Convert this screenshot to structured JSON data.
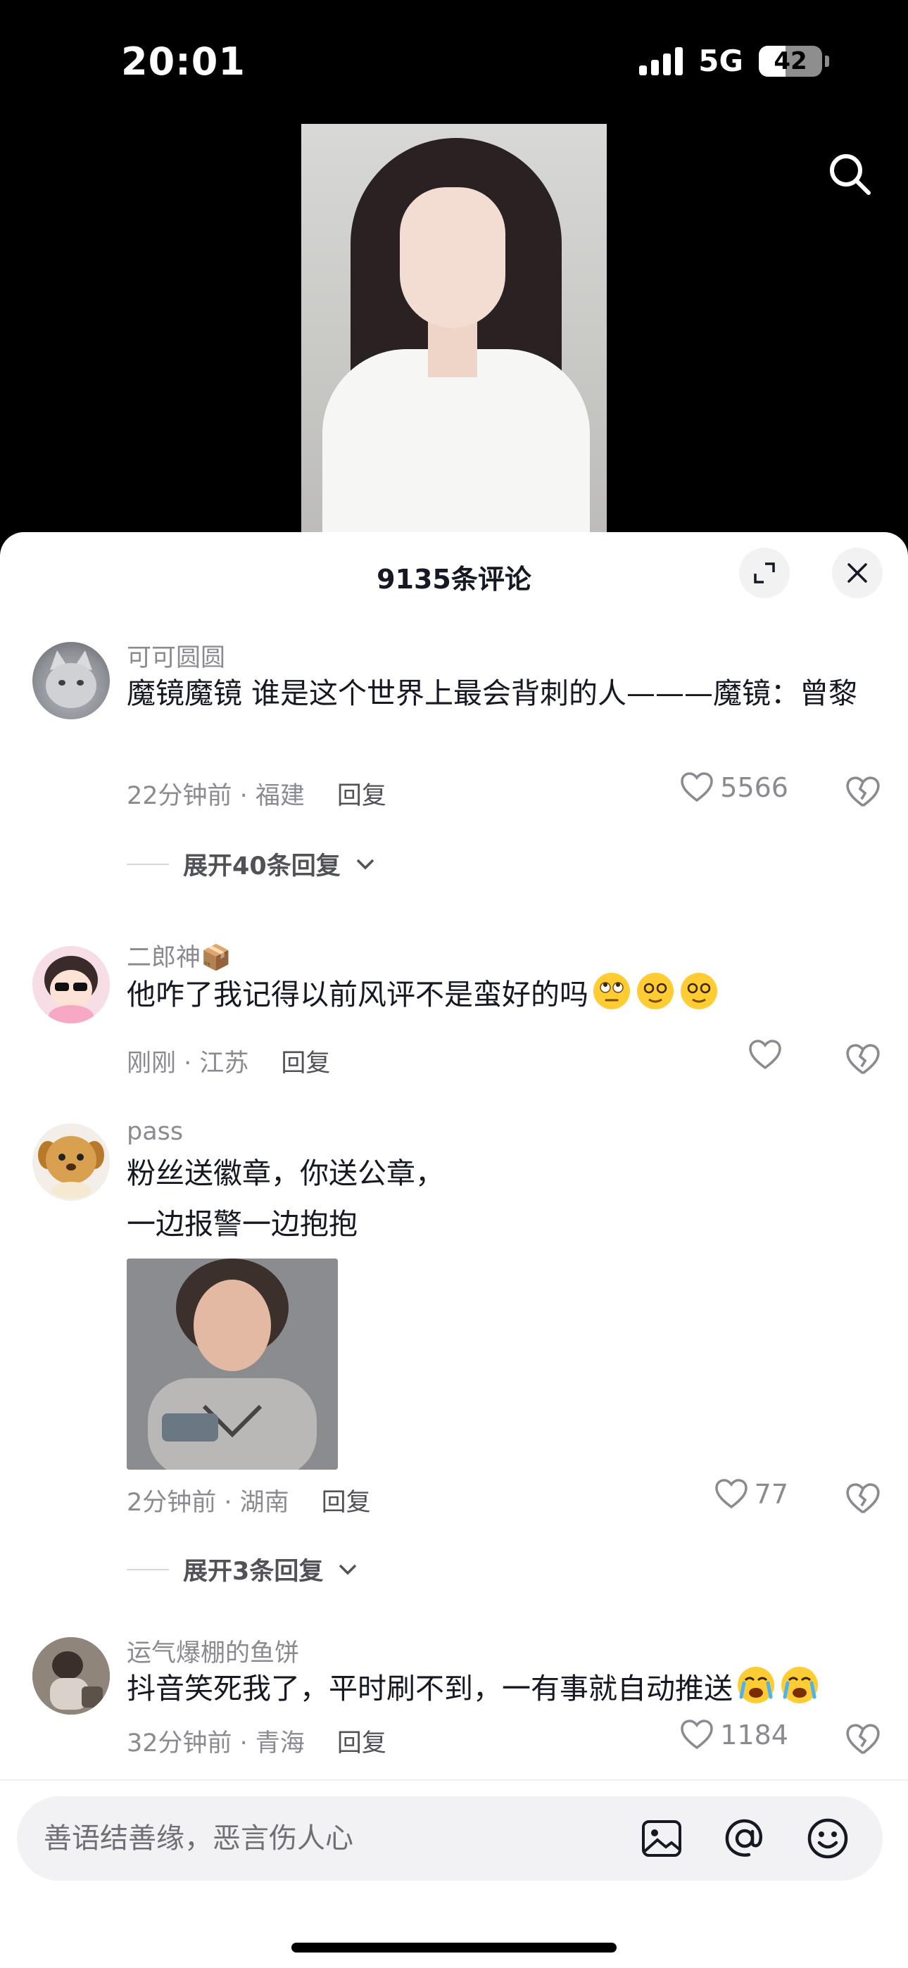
{
  "status_bar": {
    "time": "20:01",
    "network": "5G",
    "battery": "42",
    "battery_level": 0.42
  },
  "comments_panel": {
    "title": "9135条评论",
    "comments": [
      {
        "username": "可可圆圆",
        "text": "魔镜魔镜 谁是这个世界上最会背刺的人———魔镜：曾黎",
        "time_location": "22分钟前 · 福建",
        "reply_label": "回复",
        "likes": "5566",
        "expand_label": "展开40条回复"
      },
      {
        "username": "二郎神📦",
        "text": "他咋了我记得以前风评不是蛮好的吗",
        "emojis": [
          "rolling-eyes-emoji",
          "dizzy-face-emoji",
          "dizzy-face-emoji"
        ],
        "time_location": "刚刚 · 江苏",
        "reply_label": "回复",
        "likes": ""
      },
      {
        "username": "pass",
        "text_line1": "粉丝送徽章，你送公章，",
        "text_line2": "一边报警一边抱抱",
        "has_image": true,
        "time_location": "2分钟前 · 湖南",
        "reply_label": "回复",
        "likes": "77",
        "expand_label": "展开3条回复"
      },
      {
        "username": "运气爆棚的鱼饼",
        "text": "抖音笑死我了，平时刷不到，一有事就自动推送",
        "emojis": [
          "crying-face-emoji",
          "crying-face-emoji"
        ],
        "time_location": "32分钟前 · 青海",
        "reply_label": "回复",
        "likes": "1184"
      }
    ]
  },
  "input": {
    "placeholder": "善语结善缘，恶言伤人心"
  },
  "icons": [
    "search-icon",
    "expand-icon",
    "close-icon",
    "heart-icon",
    "broken-heart-icon",
    "chevron-down-icon",
    "image-icon",
    "at-icon",
    "smile-icon"
  ]
}
